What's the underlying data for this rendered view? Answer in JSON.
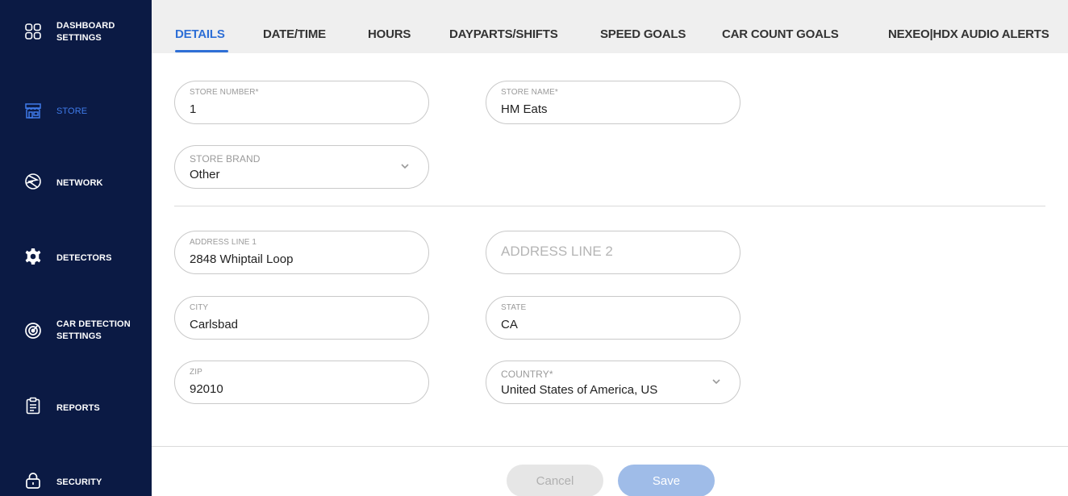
{
  "sidebar": {
    "items": [
      {
        "label_line1": "DASHBOARD",
        "label_line2": "SETTINGS",
        "icon": "grid-icon"
      },
      {
        "label_line1": "STORE",
        "label_line2": "",
        "icon": "store-icon",
        "active": true
      },
      {
        "label_line1": "NETWORK",
        "label_line2": "",
        "icon": "network-icon"
      },
      {
        "label_line1": "DETECTORS",
        "label_line2": "",
        "icon": "gear-icon"
      },
      {
        "label_line1": "CAR DETECTION",
        "label_line2": "SETTINGS",
        "icon": "radar-icon"
      },
      {
        "label_line1": "REPORTS",
        "label_line2": "",
        "icon": "clipboard-icon"
      },
      {
        "label_line1": "SECURITY",
        "label_line2": "",
        "icon": "lock-icon"
      }
    ],
    "colors": {
      "background": "#0b1a44",
      "active": "#3f7bea"
    }
  },
  "tabs": [
    {
      "label": "DETAILS",
      "active": true
    },
    {
      "label": "DATE/TIME"
    },
    {
      "label": "HOURS"
    },
    {
      "label": "DAYPARTS/SHIFTS"
    },
    {
      "label": "SPEED GOALS"
    },
    {
      "label": "CAR COUNT GOALS"
    },
    {
      "label": "NEXEO|HDX AUDIO ALERTS"
    }
  ],
  "form": {
    "store_number": {
      "label": "STORE NUMBER*",
      "value": "1"
    },
    "store_name": {
      "label": "STORE NAME*",
      "value": "HM Eats"
    },
    "store_brand": {
      "label": "STORE BRAND",
      "value": "Other"
    },
    "address_line1": {
      "label": "ADDRESS LINE 1",
      "value": "2848 Whiptail Loop"
    },
    "address_line2": {
      "placeholder": "ADDRESS LINE 2"
    },
    "city": {
      "label": "CITY",
      "value": "Carlsbad"
    },
    "state": {
      "label": "STATE",
      "value": "CA"
    },
    "zip": {
      "label": "ZIP",
      "value": "92010"
    },
    "country": {
      "label": "COUNTRY*",
      "value": "United States of America, US"
    }
  },
  "buttons": {
    "cancel": "Cancel",
    "save": "Save"
  },
  "colors": {
    "accent": "#2e6fd6",
    "save_button": "#9fbce8"
  }
}
